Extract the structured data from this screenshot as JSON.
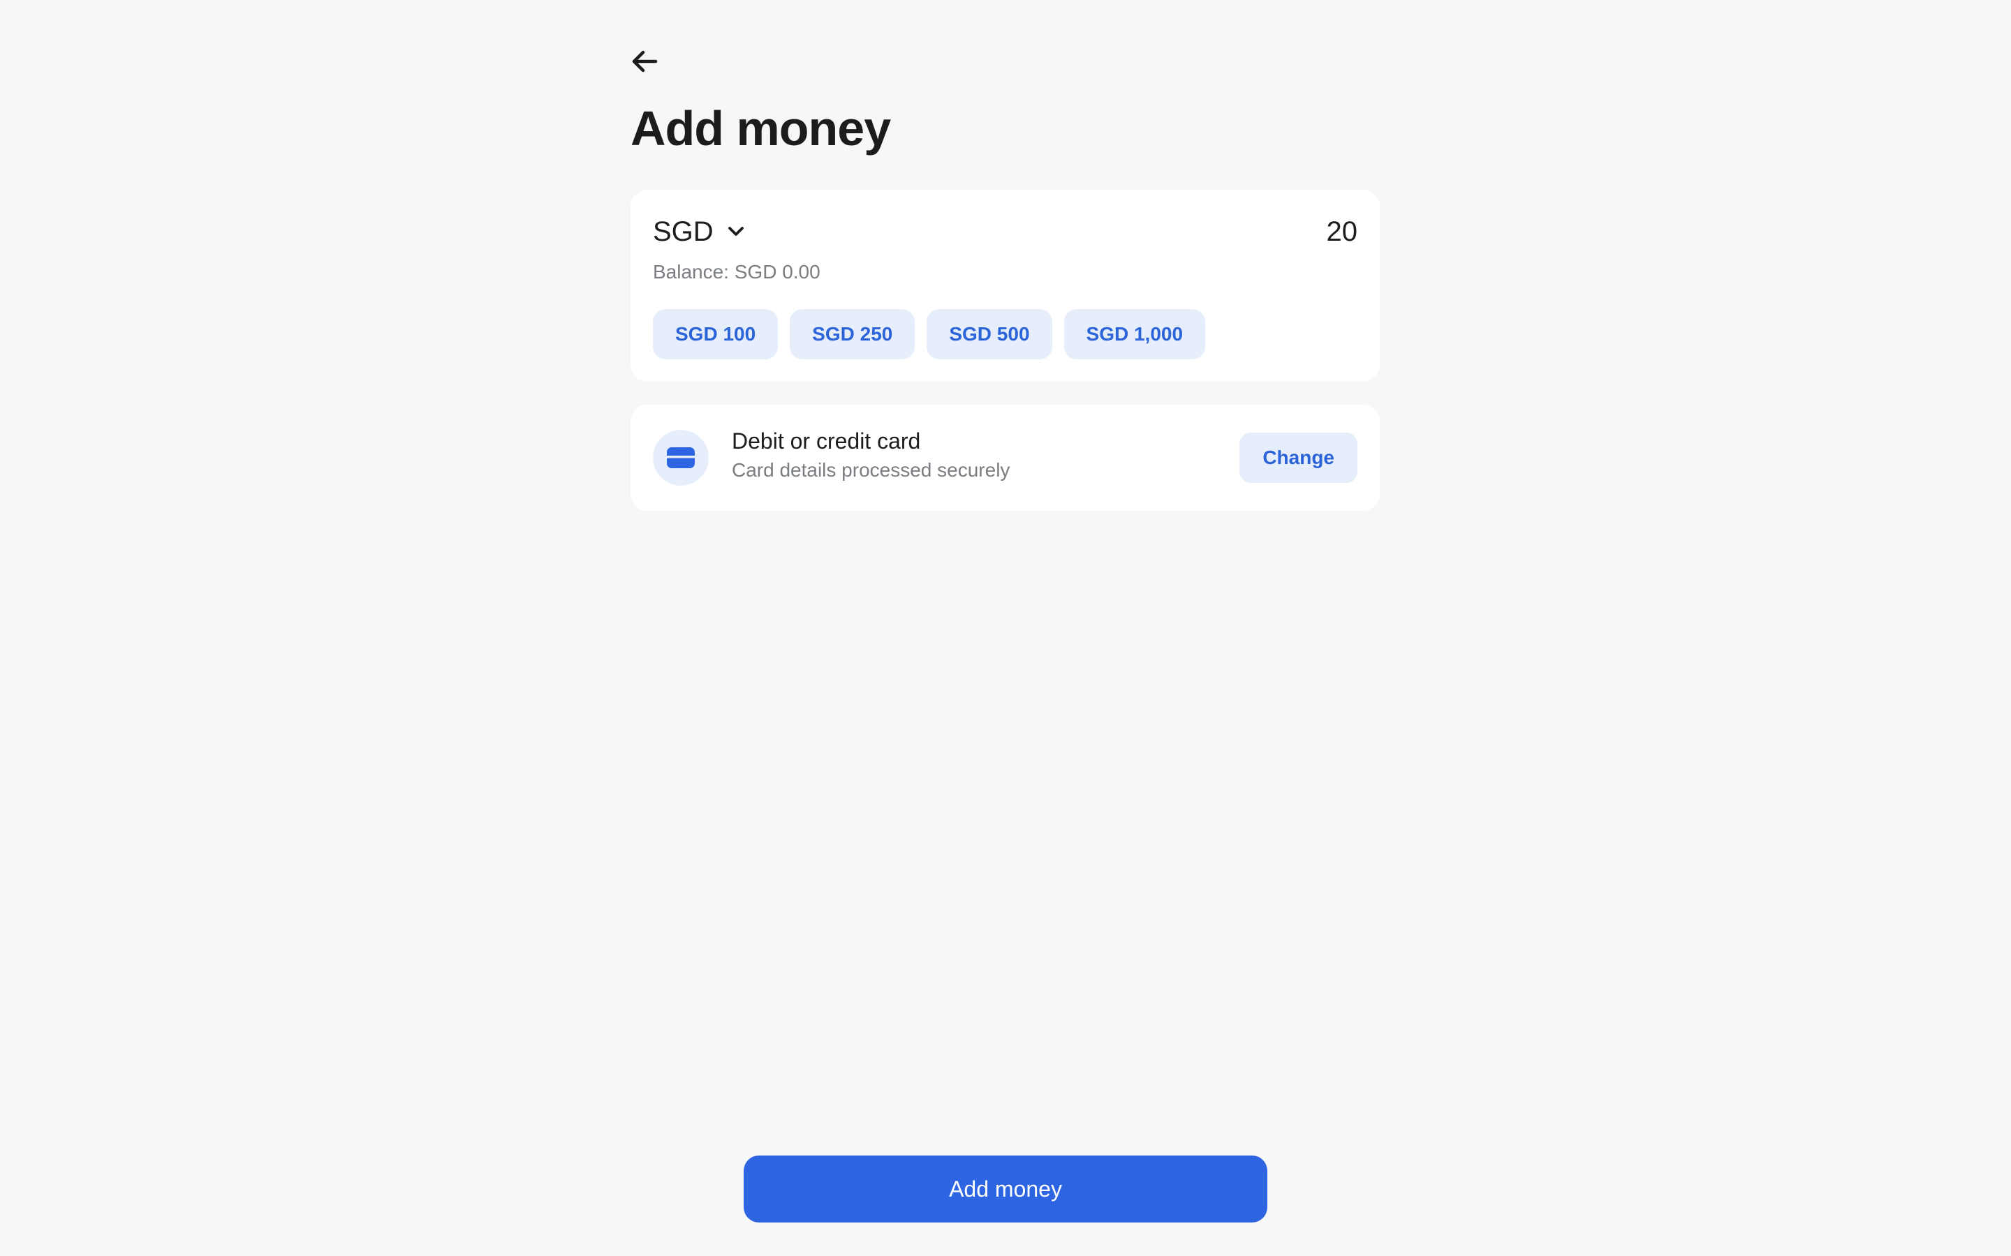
{
  "header": {
    "back_icon": "arrow-left-icon",
    "title": "Add money"
  },
  "amount": {
    "currency": "SGD",
    "currency_icon": "chevron-down-icon",
    "value": "20",
    "balance": "Balance: SGD 0.00",
    "quick_amounts": [
      "SGD 100",
      "SGD 250",
      "SGD 500",
      "SGD 1,000"
    ]
  },
  "payment_method": {
    "icon": "credit-card-icon",
    "title": "Debit or credit card",
    "subtitle": "Card details processed securely",
    "change_label": "Change"
  },
  "footer": {
    "submit_label": "Add money"
  },
  "colors": {
    "accent": "#2c64e1",
    "accent_soft": "#e7eefb",
    "background": "#f7f7f7",
    "muted_text": "#7a7d82"
  }
}
